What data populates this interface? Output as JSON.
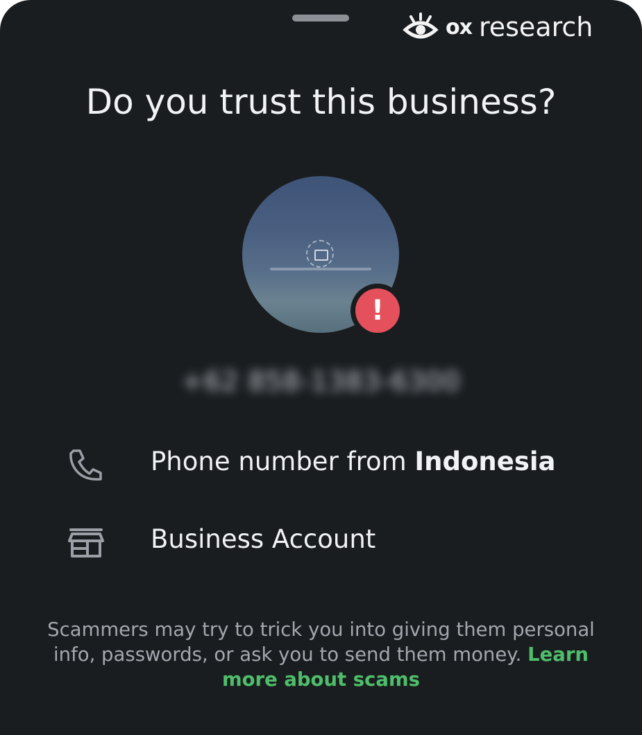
{
  "watermark": {
    "brand_ox": "ox",
    "brand_research": "research",
    "icon": "eye-icon"
  },
  "dialog": {
    "title": "Do you trust this business?",
    "phone_number": "+62 858-1383-6300",
    "alert_glyph": "!",
    "rows": [
      {
        "icon": "phone-icon",
        "label_prefix": "Phone number from ",
        "label_strong": "Indonesia"
      },
      {
        "icon": "storefront-icon",
        "label": "Business Account"
      }
    ],
    "disclaimer_text": "Scammers may try to trick you into giving them personal info, passwords, or ask you to send them money. ",
    "learn_more_link": "Learn more about scams"
  },
  "colors": {
    "background": "#1a1d20",
    "text": "#f1f2f4",
    "muted_text": "#a3a8ae",
    "link": "#4fbe6a",
    "alert_badge": "#e4515c",
    "handle": "#8d9196"
  }
}
